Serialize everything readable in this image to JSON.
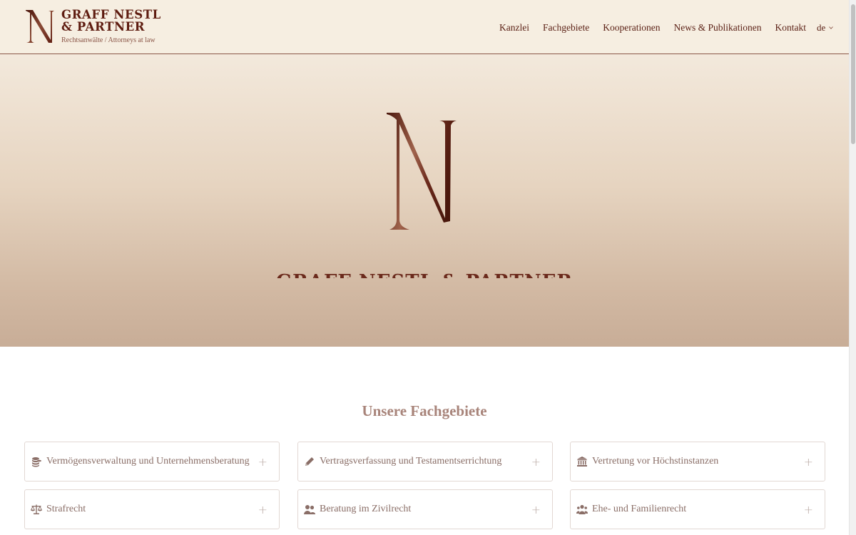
{
  "brand": {
    "name": "GRAFF NESTL & PARTNER",
    "name_line1": "GRAFF NESTL",
    "name_line2": "& PARTNER",
    "tagline": "Rechtsanwälte / Attorneys at law",
    "primary_color": "#5e1c10",
    "accent_color": "#8a5547"
  },
  "nav": {
    "items": [
      {
        "label": "Kanzlei"
      },
      {
        "label": "Fachgebiete"
      },
      {
        "label": "Kooperationen"
      },
      {
        "label": "News & Publikationen"
      },
      {
        "label": "Kontakt"
      }
    ],
    "language": "de",
    "language_icon": "chevron-down-icon"
  },
  "hero": {
    "title": "GRAFF NESTL & PARTNER",
    "logo_icon": "monogram-n-icon"
  },
  "section": {
    "title": "Unsere Fachgebiete",
    "cards": [
      {
        "label": "Vermögensverwaltung und Unternehmensberatung",
        "icon": "coins-icon",
        "expand": "+"
      },
      {
        "label": "Vertragsverfassung und Testamentserrichtung",
        "icon": "pencil-icon",
        "expand": "+"
      },
      {
        "label": "Vertretung vor Höchstinstanzen",
        "icon": "courthouse-icon",
        "expand": "+"
      },
      {
        "label": "Strafrecht",
        "icon": "scales-icon",
        "expand": "+"
      },
      {
        "label": "Beratung im Zivilrecht",
        "icon": "users-icon",
        "expand": "+"
      },
      {
        "label": "Ehe- und Familienrecht",
        "icon": "family-icon",
        "expand": "+"
      }
    ]
  }
}
